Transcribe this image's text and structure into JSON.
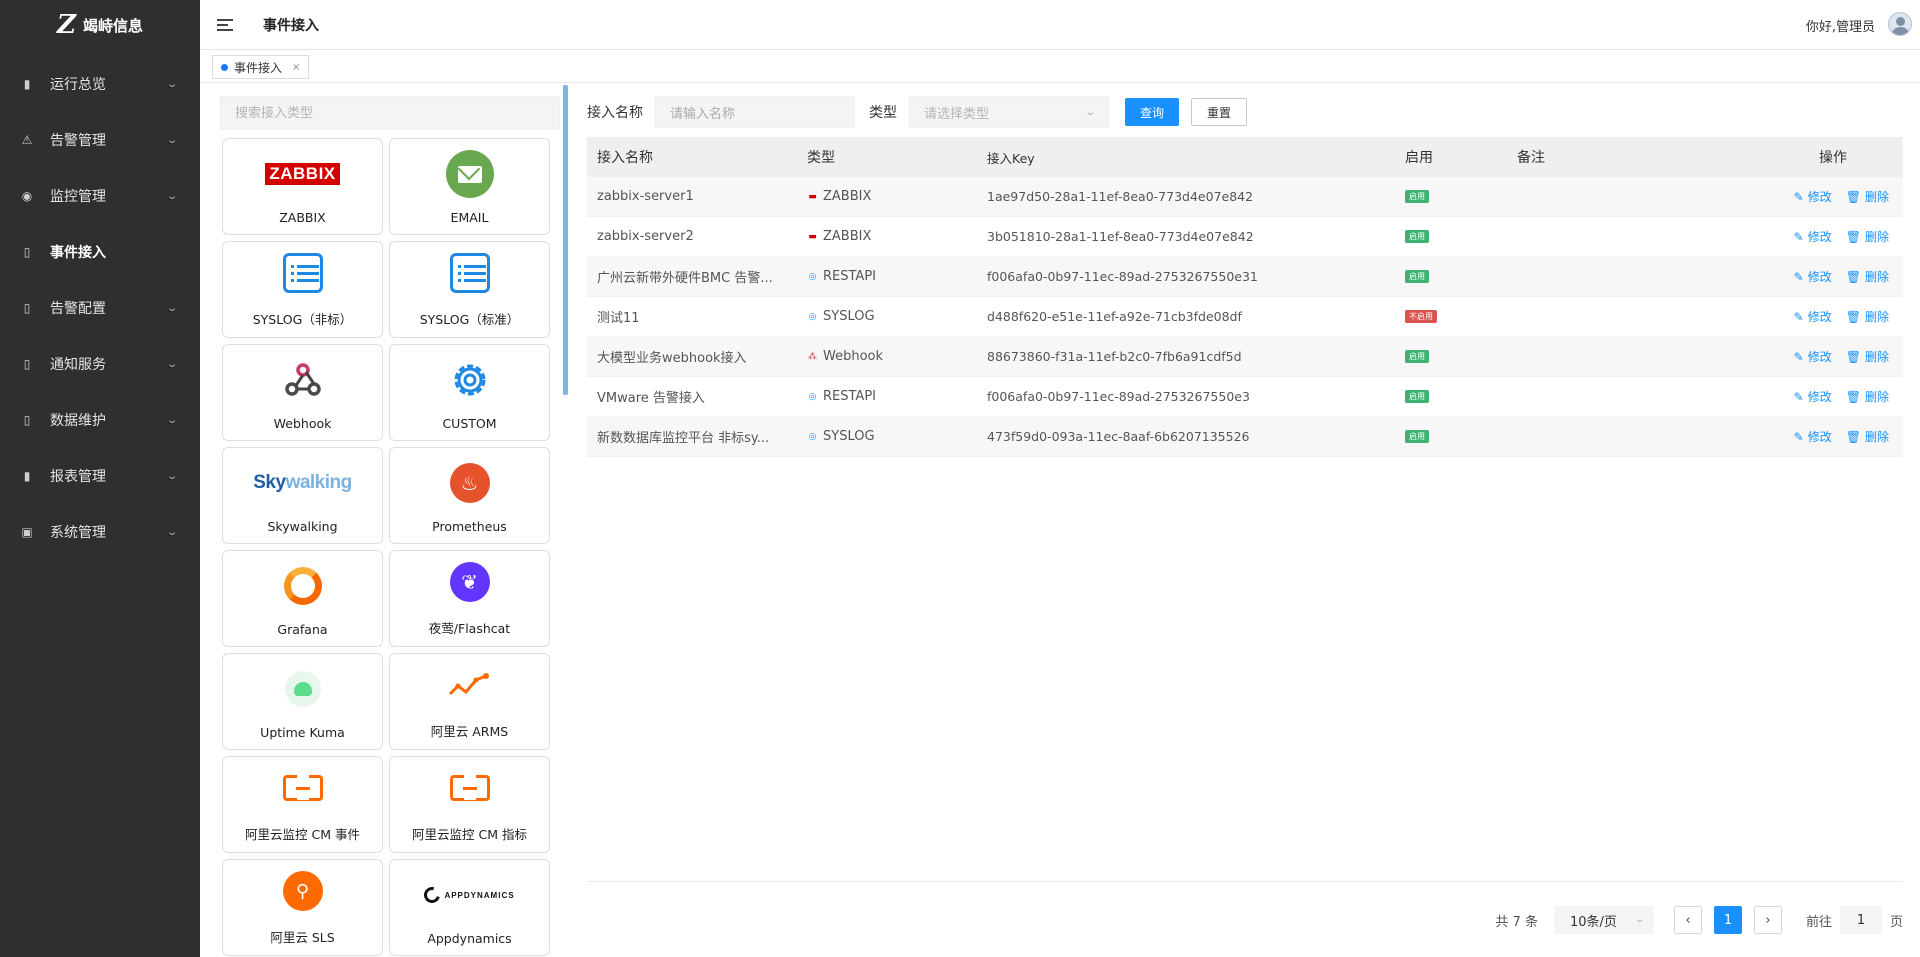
{
  "brand": {
    "name": "竭峙信息",
    "mark": "Z"
  },
  "sidebar": {
    "items": [
      {
        "label": "运行总览",
        "icon": "bar-chart-icon",
        "glyph": "▮",
        "active": false,
        "arrow": "⌄"
      },
      {
        "label": "告警管理",
        "icon": "alarm-icon",
        "glyph": "⚠",
        "active": false,
        "arrow": "⌄"
      },
      {
        "label": "监控管理",
        "icon": "eye-icon",
        "glyph": "◉",
        "active": false,
        "arrow": "⌄"
      },
      {
        "label": "事件接入",
        "icon": "document-icon",
        "glyph": "▯",
        "active": true,
        "arrow": ""
      },
      {
        "label": "告警配置",
        "icon": "document-icon",
        "glyph": "▯",
        "active": false,
        "arrow": "⌄"
      },
      {
        "label": "通知服务",
        "icon": "document-icon",
        "glyph": "▯",
        "active": false,
        "arrow": "⌄"
      },
      {
        "label": "数据维护",
        "icon": "document-icon",
        "glyph": "▯",
        "active": false,
        "arrow": "⌄"
      },
      {
        "label": "报表管理",
        "icon": "bar-chart-icon",
        "glyph": "▮",
        "active": false,
        "arrow": "⌄"
      },
      {
        "label": "系统管理",
        "icon": "settings-icon",
        "glyph": "▣",
        "active": false,
        "arrow": "⌄"
      }
    ]
  },
  "header": {
    "title": "事件接入",
    "greeting": "你好,管理员"
  },
  "tabs": [
    {
      "label": "事件接入",
      "close": "×"
    }
  ],
  "left_panel": {
    "search_placeholder": "搜索接入类型",
    "cards": [
      {
        "label": "ZABBIX",
        "logo": "zabbix-logo"
      },
      {
        "label": "EMAIL",
        "logo": "email-icon"
      },
      {
        "label": "SYSLOG（非标）",
        "logo": "list-icon"
      },
      {
        "label": "SYSLOG（标准）",
        "logo": "list-icon"
      },
      {
        "label": "Webhook",
        "logo": "webhook-icon"
      },
      {
        "label": "CUSTOM",
        "logo": "gear-icon"
      },
      {
        "label": "Skywalking",
        "logo": "skywalking-logo"
      },
      {
        "label": "Prometheus",
        "logo": "prometheus-icon"
      },
      {
        "label": "Grafana",
        "logo": "grafana-icon"
      },
      {
        "label": "夜莺/Flashcat",
        "logo": "flashcat-icon"
      },
      {
        "label": "Uptime Kuma",
        "logo": "uptime-kuma-icon"
      },
      {
        "label": "阿里云 ARMS",
        "logo": "arms-icon"
      },
      {
        "label": "阿里云监控 CM 事件",
        "logo": "aliyun-icon"
      },
      {
        "label": "阿里云监控 CM 指标",
        "logo": "aliyun-icon"
      },
      {
        "label": "阿里云 SLS",
        "logo": "sls-icon"
      },
      {
        "label": "Appdynamics",
        "logo": "appdynamics-logo"
      }
    ],
    "logo_texts": {
      "zabbix": "ZABBIX",
      "skywalking_a": "Sky",
      "skywalking_b": "walking",
      "appd": "APPDYNAMICS"
    }
  },
  "filter": {
    "name_label": "接入名称",
    "name_placeholder": "请输入名称",
    "type_label": "类型",
    "type_placeholder": "请选择类型",
    "query_button": "查询",
    "reset_button": "重置"
  },
  "table": {
    "headers": [
      "接入名称",
      "类型",
      "接入Key",
      "启用",
      "备注",
      "操作"
    ],
    "rows": [
      {
        "name": "zabbix-server1",
        "type": "ZABBIX",
        "type_icon": "zabbix-icon",
        "key": "1ae97d50-28a1-11ef-8ea0-773d4e07e842",
        "status": "启用",
        "enabled": true,
        "remark": ""
      },
      {
        "name": "zabbix-server2",
        "type": "ZABBIX",
        "type_icon": "zabbix-icon",
        "key": "3b051810-28a1-11ef-8ea0-773d4e07e842",
        "status": "启用",
        "enabled": true,
        "remark": ""
      },
      {
        "name": "广州云新带外硬件BMC 告警...",
        "type": "RESTAPI",
        "type_icon": "restapi-icon",
        "key": "f006afa0-0b97-11ec-89ad-2753267550e31",
        "status": "启用",
        "enabled": true,
        "remark": ""
      },
      {
        "name": "测试11",
        "type": "SYSLOG",
        "type_icon": "syslog-icon",
        "key": "d488f620-e51e-11ef-a92e-71cb3fde08df",
        "status": "不启用",
        "enabled": false,
        "remark": ""
      },
      {
        "name": "大模型业务webhook接入",
        "type": "Webhook",
        "type_icon": "webhook-icon",
        "key": "88673860-f31a-11ef-b2c0-7fb6a91cdf5d",
        "status": "启用",
        "enabled": true,
        "remark": ""
      },
      {
        "name": "VMware 告警接入",
        "type": "RESTAPI",
        "type_icon": "restapi-icon",
        "key": "f006afa0-0b97-11ec-89ad-2753267550e3",
        "status": "启用",
        "enabled": true,
        "remark": ""
      },
      {
        "name": "新数数据库监控平台 非标sy...",
        "type": "SYSLOG",
        "type_icon": "syslog-icon",
        "key": "473f59d0-093a-11ec-8aaf-6b6207135526",
        "status": "启用",
        "enabled": true,
        "remark": ""
      }
    ],
    "edit_label": "修改",
    "delete_label": "删除"
  },
  "pagination": {
    "total": "共 7 条",
    "page_size": "10条/页",
    "current_page": "1",
    "goto_prefix": "前往",
    "goto_value": "1",
    "goto_suffix": "页"
  },
  "colors": {
    "accent": "#1890ff",
    "sidebar_bg": "#2f2f2f",
    "enabled": "#3cb371",
    "disabled": "#d9534f"
  }
}
